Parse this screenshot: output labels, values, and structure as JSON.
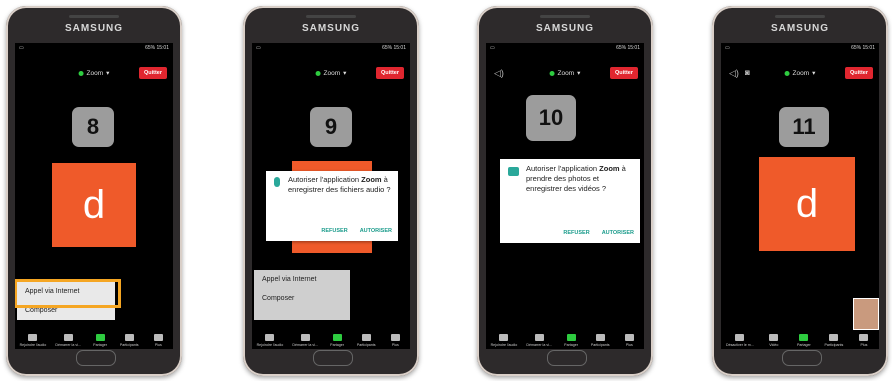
{
  "brand": "SAMSUNG",
  "status_time": "65% 15:01",
  "zoom_label": "Zoom",
  "quit_label": "Quitter",
  "tile_letter": "d",
  "bottom_items_a": [
    "Rejoindre l'audio",
    "Démarrer la vi...",
    "Partager",
    "Participants",
    "Plus"
  ],
  "bottom_items_b": [
    "Désactiver le m...",
    "Vidéo",
    "Partager",
    "Participants",
    "Plus"
  ],
  "menu_items": [
    "Appel via Internet",
    "Composer"
  ],
  "steps": [
    "8",
    "9",
    "10",
    "11"
  ],
  "dialog_audio": {
    "line1": "Autoriser l'application",
    "bold": "Zoom",
    "rest": "à enregistrer des fichiers audio ?",
    "deny": "REFUSER",
    "allow": "AUTORISER"
  },
  "dialog_video": {
    "line1": "Autoriser l'application",
    "bold": "Zoom",
    "rest": "à prendre des photos et enregistrer des vidéos ?",
    "deny": "REFUSER",
    "allow": "AUTORISER"
  },
  "colors": {
    "accent_orange": "#ef5a2a",
    "highlight": "#f5a623",
    "quit_red": "#e0262f",
    "dialog_teal": "#1c9c8c"
  }
}
